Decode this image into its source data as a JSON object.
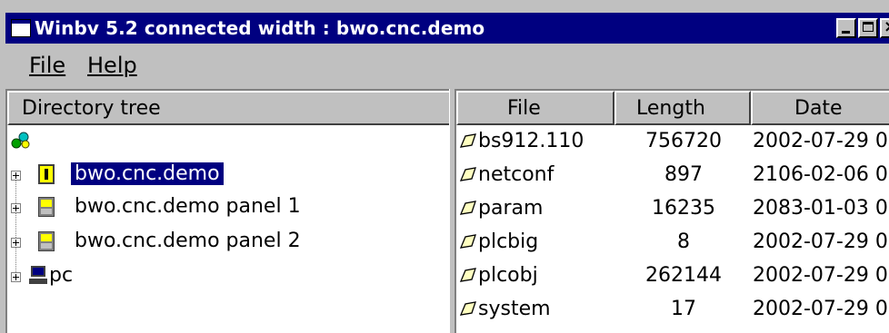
{
  "window": {
    "title": "Winbv 5.2 connected width : bwo.cnc.demo"
  },
  "menu": {
    "file_label": "File",
    "help_label": "Help"
  },
  "tree": {
    "header": "Directory tree",
    "nodes": [
      {
        "label": "bwo.cnc.demo",
        "icon": "cnc-machine-icon",
        "selected": true
      },
      {
        "label": "bwo.cnc.demo panel 1",
        "icon": "panel-icon",
        "selected": false
      },
      {
        "label": "bwo.cnc.demo panel 2",
        "icon": "panel-icon",
        "selected": false
      },
      {
        "label": "pc",
        "icon": "computer-icon",
        "selected": false
      }
    ]
  },
  "files": {
    "columns": {
      "file": "File",
      "length": "Length",
      "date": "Date"
    },
    "rows": [
      {
        "name": "bs912.110",
        "length": "756720",
        "date": "2002-07-29 0"
      },
      {
        "name": "netconf",
        "length": "897",
        "date": "2106-02-06 0"
      },
      {
        "name": "param",
        "length": "16235",
        "date": "2083-01-03 0"
      },
      {
        "name": "plcbig",
        "length": "8",
        "date": "2002-07-29 0"
      },
      {
        "name": "plcobj",
        "length": "262144",
        "date": "2002-07-29 0"
      },
      {
        "name": "system",
        "length": "17",
        "date": "2002-07-29 0"
      }
    ]
  },
  "colors": {
    "titlebar": "#000080",
    "selection": "#000080",
    "face": "#c0c0c0"
  }
}
